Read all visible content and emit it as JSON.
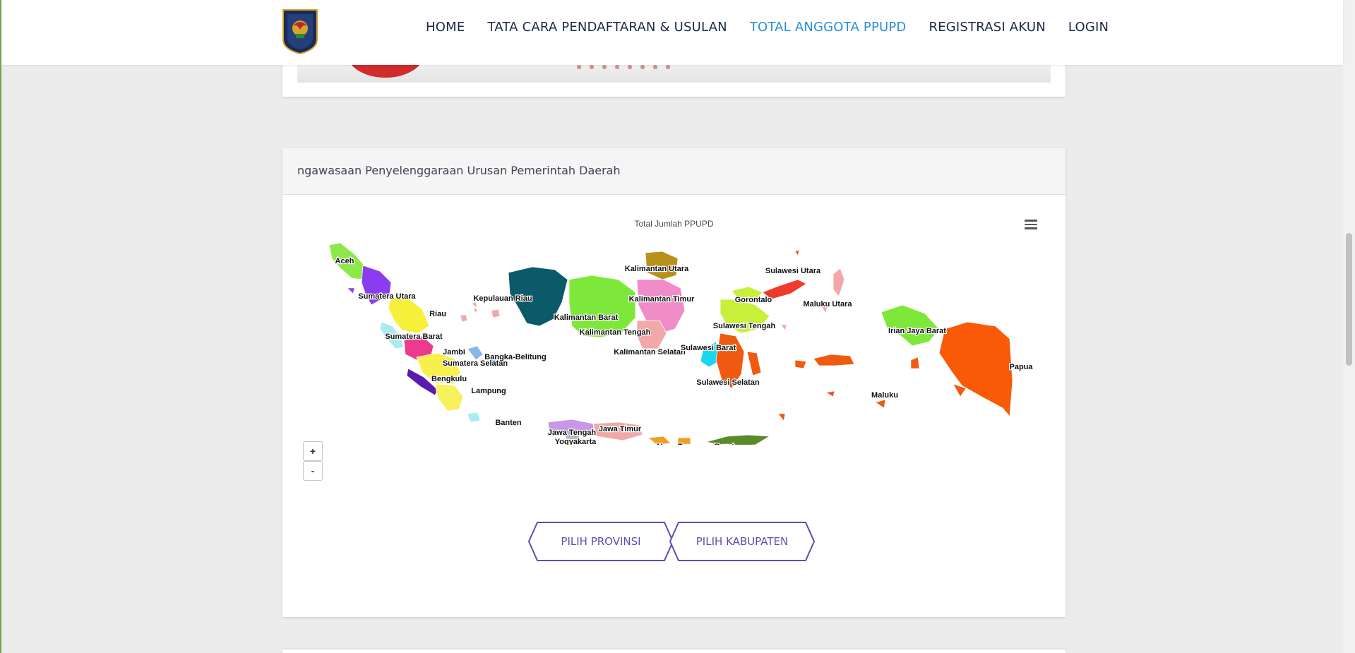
{
  "nav": {
    "items": [
      {
        "label": "HOME",
        "active": false
      },
      {
        "label": "TATA CARA PENDAFTARAN & USULAN",
        "active": false
      },
      {
        "label": "TOTAL ANGGOTA PPUPD",
        "active": true
      },
      {
        "label": "REGISTRASI AKUN",
        "active": false
      },
      {
        "label": "LOGIN",
        "active": false
      }
    ],
    "active_color": "#2a8fd8",
    "text_color": "#1b2a4a"
  },
  "panel": {
    "title": "ngawasaan Penyelenggaraan Urusan Pemerintah Daerah"
  },
  "map": {
    "title": "Total Jumlah PPUPD",
    "zoom_in_label": "+",
    "zoom_out_label": "-",
    "menu_icon": "hamburger-menu-icon",
    "provinces": [
      {
        "name": "Aceh",
        "color": "#8fe84a"
      },
      {
        "name": "Sumatera Utara",
        "color": "#8b3cf0"
      },
      {
        "name": "Riau",
        "color": "#f5f03a"
      },
      {
        "name": "Kepulauan Riau",
        "color": "#f0a8a8"
      },
      {
        "name": "Sumatera Barat",
        "color": "#a8ecf0"
      },
      {
        "name": "Jambi",
        "color": "#ee3a8c"
      },
      {
        "name": "Sumatera Selatan",
        "color": "#f8f04a"
      },
      {
        "name": "Bangka-Belitung",
        "color": "#88b8e8"
      },
      {
        "name": "Bengkulu",
        "color": "#5a1ab0"
      },
      {
        "name": "Lampung",
        "color": "#f8f05a"
      },
      {
        "name": "Banten",
        "color": "#a8ecf0"
      },
      {
        "name": "Jawa Tengah",
        "color": "#c898e8"
      },
      {
        "name": "Yogyakarta",
        "color": "#b8b8b8"
      },
      {
        "name": "Jawa Timur",
        "color": "#f2a8a8"
      },
      {
        "name": "Kalimantan Barat",
        "color": "#0a5a6a"
      },
      {
        "name": "Kalimantan Utara",
        "color": "#b8901a"
      },
      {
        "name": "Kalimantan Timur",
        "color": "#f08cc8"
      },
      {
        "name": "Kalimantan Tengah",
        "color": "#7ee83a"
      },
      {
        "name": "Kalimantan Selatan",
        "color": "#f2a8a8"
      },
      {
        "name": "Sulawesi Utara",
        "color": "#f03a2a"
      },
      {
        "name": "Gorontalo",
        "color": "#c8f03a"
      },
      {
        "name": "Sulawesi Tengah",
        "color": "#c8f03a"
      },
      {
        "name": "Sulawesi Barat",
        "color": "#18d8f0"
      },
      {
        "name": "Sulawesi Selatan",
        "color": "#f05a10"
      },
      {
        "name": "Maluku Utara",
        "color": "#f2a8a8"
      },
      {
        "name": "Maluku",
        "color": "#f05a10"
      },
      {
        "name": "Irian Jaya Barat",
        "color": "#7ee83a"
      },
      {
        "name": "Papua",
        "color": "#f85a08"
      },
      {
        "name": "Nusa Tenggara Barat",
        "color": "#f0a020"
      },
      {
        "name": "Nusa Tenggara Timur",
        "color": "#5a8a2a"
      }
    ]
  },
  "buttons": {
    "provinsi": "PILIH PROVINSI",
    "kabupaten": "PILIH KABUPATEN",
    "accent": "#5a4fb0"
  }
}
